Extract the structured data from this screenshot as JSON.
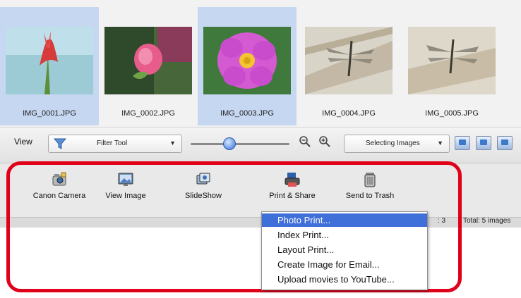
{
  "thumbnails": [
    {
      "name": "IMG_0001.JPG",
      "selected": true
    },
    {
      "name": "IMG_0002.JPG",
      "selected": false
    },
    {
      "name": "IMG_0003.JPG",
      "selected": true
    },
    {
      "name": "IMG_0004.JPG",
      "selected": false
    },
    {
      "name": "IMG_0005.JPG",
      "selected": false
    }
  ],
  "toolbar": {
    "view_label": "View",
    "filter_value": "Filter Tool",
    "selecting_value": "Selecting Images"
  },
  "actions": [
    {
      "label": "Canon Camera",
      "icon": "camera-icon"
    },
    {
      "label": "View Image",
      "icon": "monitor-icon"
    },
    {
      "label": "SlideShow",
      "icon": "slideshow-icon"
    },
    {
      "label": "Print & Share",
      "icon": "printer-icon"
    },
    {
      "label": "Send to Trash",
      "icon": "trash-icon"
    }
  ],
  "status": {
    "partial": ": 3",
    "total": "Total: 5 images"
  },
  "menu": {
    "items": [
      "Photo Print...",
      "Index Print...",
      "Layout Print...",
      "Create Image for Email...",
      "Upload movies to YouTube..."
    ],
    "active_index": 0
  },
  "colors": {
    "selection": "#c6d7f1",
    "highlight": "#e1001a",
    "menu_active": "#3f6fd8"
  }
}
